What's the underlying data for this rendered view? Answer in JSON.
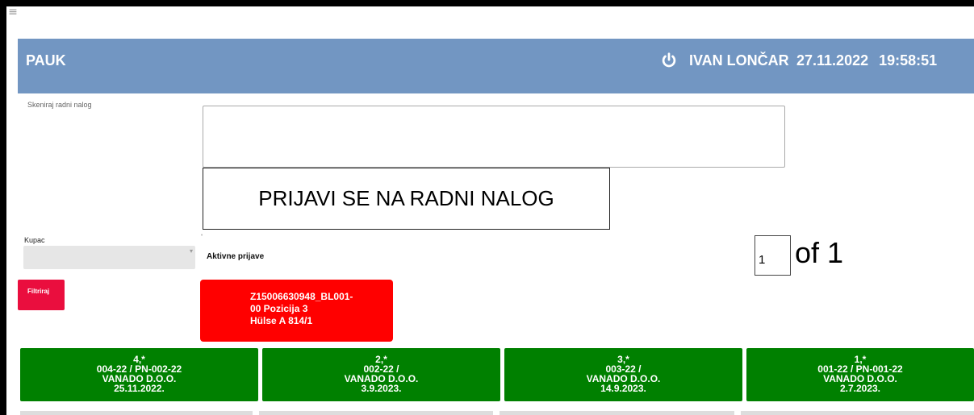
{
  "header": {
    "app_title": "PAUK",
    "user_name": "IVAN LONČAR",
    "date": "27.11.2022",
    "time": "19:58:51",
    "power_icon": "power-icon",
    "bg_color": "#7296c2"
  },
  "scan": {
    "label": "Skeniraj radni nalog",
    "value": ""
  },
  "login_button": "PRIJAVI SE NA RADNI NALOG",
  "filter": {
    "kupac_label": "Kupac",
    "kupac_value": "",
    "filter_button": "Filtriraj"
  },
  "active": {
    "label": "Aktivne prijave",
    "card": {
      "line1": "Z15006630948_BL001-",
      "line2": "00 Pozicija 3",
      "line3": "Hülse A 814/1",
      "color": "#ff0000"
    }
  },
  "pagination": {
    "current": "1",
    "of_text": "of 1"
  },
  "orders": [
    {
      "line1": "4,*",
      "line2": "004-22 / PN-002-22",
      "line3": "VANADO D.O.O.",
      "line4": "25.11.2022."
    },
    {
      "line1": "2,*",
      "line2": "002-22 /",
      "line3": "VANADO D.O.O.",
      "line4": "3.9.2023."
    },
    {
      "line1": "3,*",
      "line2": "003-22 /",
      "line3": "VANADO D.O.O.",
      "line4": "14.9.2023."
    },
    {
      "line1": "1,*",
      "line2": "001-22 / PN-001-22",
      "line3": "VANADO D.O.O.",
      "line4": "2.7.2023."
    }
  ],
  "colors": {
    "order_green": "#008000",
    "filter_red": "#ea0e3e"
  }
}
